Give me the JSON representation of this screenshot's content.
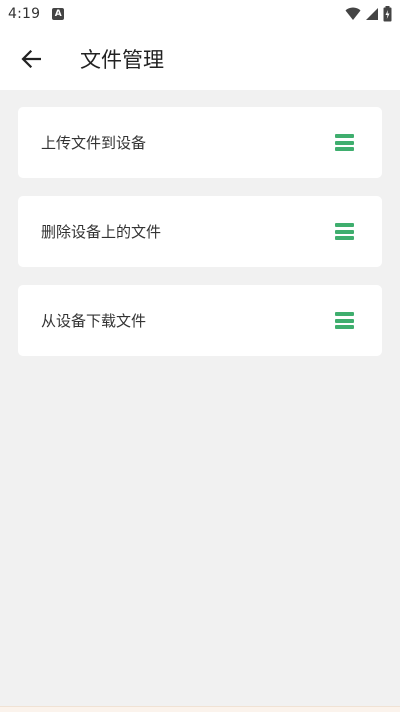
{
  "status_bar": {
    "time": "4:19",
    "notification_icon": "A",
    "icons": [
      "wifi-icon",
      "signal-icon",
      "battery-charging-icon"
    ]
  },
  "toolbar": {
    "back_icon": "arrow-left-icon",
    "title": "文件管理"
  },
  "items": [
    {
      "label": "上传文件到设备",
      "icon": "menu-icon"
    },
    {
      "label": "删除设备上的文件",
      "icon": "menu-icon"
    },
    {
      "label": "从设备下载文件",
      "icon": "menu-icon"
    }
  ],
  "colors": {
    "accent": "#3fae6e",
    "background": "#f1f1f1",
    "card": "#ffffff",
    "text": "#333333"
  }
}
